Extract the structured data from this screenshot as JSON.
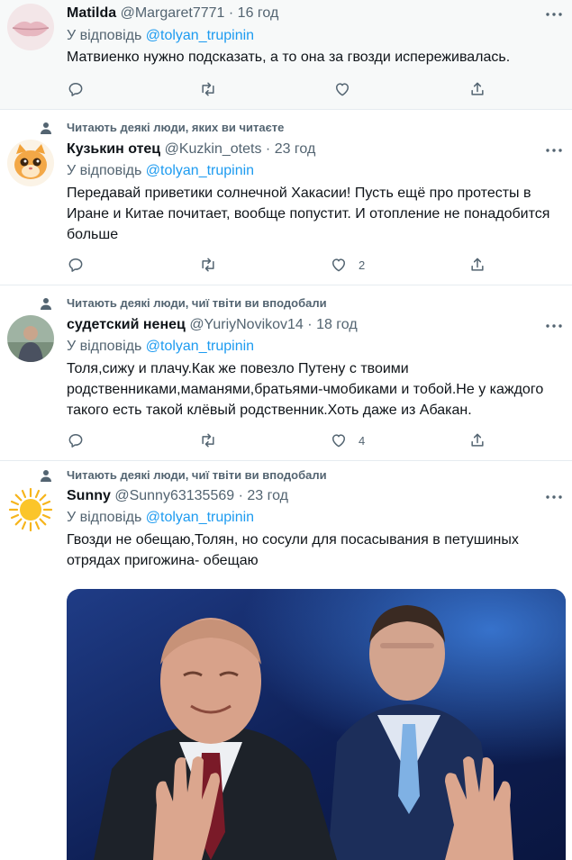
{
  "reply_prefix": "У відповідь",
  "tweets": [
    {
      "social_context": "",
      "name": "Matilda",
      "handle": "@Margaret7771",
      "separator": "·",
      "time": "16 год",
      "reply_to": "@tolyan_trupinin",
      "text": "Матвиенко нужно подсказать, а то она за гвозди испереживалась.",
      "likes": ""
    },
    {
      "social_context": "Читають деякі люди, яких ви читаєте",
      "name": "Кузькин отец",
      "handle": "@Kuzkin_otets",
      "separator": "·",
      "time": "23 год",
      "reply_to": "@tolyan_trupinin",
      "text": "Передавай приветики солнечной Хакасии! Пусть ещё про протесты в Иране и Китае почитает, вообще попустит. И отопление не понадобится больше",
      "likes": "2"
    },
    {
      "social_context": "Читають деякі люди, чиї твіти ви вподобали",
      "name": "судетский ненец",
      "handle": "@YuriyNovikov14",
      "separator": "·",
      "time": "18 год",
      "reply_to": "@tolyan_trupinin",
      "text": "Толя,сижу и плачу.Как же повезло Путену с твоими родственниками,маманями,братьями-чмобиками и тобой.Не у каждого такого есть такой клёвый родственник.Хоть даже из Абакан.",
      "likes": "4"
    },
    {
      "social_context": "Читають деякі люди, чиї твіти ви вподобали",
      "name": "Sunny",
      "handle": "@Sunny63135569",
      "separator": "·",
      "time": "23 год",
      "reply_to": "@tolyan_trupinin",
      "text": "Гвозди не обещаю,Толян, но сосули для посасывания в петушиных отрядах пригожина- обещаю"
    }
  ],
  "icons": {
    "reply": "reply-icon",
    "retweet": "retweet-icon",
    "like": "like-icon",
    "share": "share-icon",
    "more": "more-icon",
    "person": "person-icon"
  },
  "colors": {
    "link": "#1d9bf0",
    "secondary": "#536471",
    "primary_text": "#0f1419",
    "highlight_bg": "#f7f9f9",
    "divider": "#e6ecf0"
  }
}
